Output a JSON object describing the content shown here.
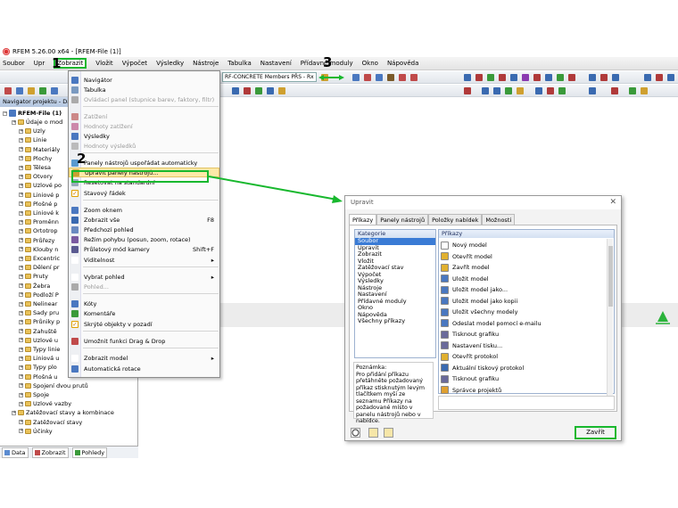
{
  "window": {
    "title": "RFEM 5.26.00 x64 - [RFEM-File (1)]"
  },
  "menubar": {
    "items": [
      "Soubor",
      "Upr",
      "Zobrazit",
      "Vložit",
      "Výpočet",
      "Výsledky",
      "Nástroje",
      "Tabulka",
      "Nastavení",
      "Přídavné moduly",
      "Okno",
      "Nápověda"
    ],
    "active": "Zobrazit"
  },
  "toolbar": {
    "combo_value": "RF-CONCRETE Members PŘS - Rx"
  },
  "navigator": {
    "title": "Navigator projektu - Dat",
    "root": "RFEM-File (1)",
    "items": [
      "Údaje o mod",
      "Uzly",
      "Linie",
      "Materiály",
      "Plochy",
      "Tělesa",
      "Otvory",
      "Uzlové po",
      "Liniové p",
      "Plošné p",
      "Liniové k",
      "Proměnn",
      "Ortotrop",
      "Průřezy",
      "Klouby n",
      "Excentric",
      "Dělení pr",
      "Pruty",
      "Žebra",
      "Podloží P",
      "Nelinear",
      "Sady pru",
      "Průniky p",
      "Zahuště",
      "Uzlové u",
      "Typy linie",
      "Liniová u",
      "Typy plo",
      "Plošná u",
      "Spojení dvou prutů",
      "Spoje",
      "Uzlové vazby",
      "Zatěžovací stavy a kombinace",
      "Zatěžovací stavy",
      "Účinky"
    ],
    "tabs": [
      "Data",
      "Zobrazit",
      "Pohledy"
    ]
  },
  "dropdown": {
    "items": [
      {
        "label": "Navigátor",
        "shortcut": ""
      },
      {
        "label": "Tabulka",
        "shortcut": ""
      },
      {
        "label": "Ovládací panel (stupnice barev, faktory, filtr)",
        "shortcut": ""
      },
      {
        "label": "Zatížení",
        "shortcut": ""
      },
      {
        "label": "Hodnoty zatížení",
        "shortcut": ""
      },
      {
        "label": "Výsledky",
        "shortcut": ""
      },
      {
        "label": "Hodnoty výsledků",
        "shortcut": ""
      },
      {
        "label": "Panely nástrojů uspořádat automaticky",
        "shortcut": ""
      },
      {
        "label": "Upravit panely nástrojů...",
        "shortcut": ""
      },
      {
        "label": "Resetovat na standardní",
        "shortcut": ""
      },
      {
        "label": "Stavový řádek",
        "shortcut": ""
      },
      {
        "label": "Zoom oknem",
        "shortcut": ""
      },
      {
        "label": "Zobrazit vše",
        "shortcut": "F8"
      },
      {
        "label": "Předchozí pohled",
        "shortcut": ""
      },
      {
        "label": "Režim pohybu (posun, zoom, rotace)",
        "shortcut": ""
      },
      {
        "label": "Průletový mód kamery",
        "shortcut": "Shift+F"
      },
      {
        "label": "Viditelnost",
        "shortcut": "▸"
      },
      {
        "label": "Vybrat pohled",
        "shortcut": "▸"
      },
      {
        "label": "Pohled...",
        "shortcut": ""
      },
      {
        "label": "Kóty",
        "shortcut": ""
      },
      {
        "label": "Komentáře",
        "shortcut": ""
      },
      {
        "label": "Skrýté objekty v pozadí",
        "shortcut": ""
      },
      {
        "label": "Umožnit funkci Drag & Drop",
        "shortcut": ""
      },
      {
        "label": "Zobrazit model",
        "shortcut": "▸"
      },
      {
        "label": "Automatická rotace",
        "shortcut": ""
      }
    ]
  },
  "markers": [
    "1",
    "2",
    "3",
    "4"
  ],
  "dialog": {
    "title": "Upravit",
    "close_glyph": "✕",
    "tabs": [
      "Příkazy",
      "Panely nástrojů",
      "Položky nabídek",
      "Možnosti"
    ],
    "categories_header": "Kategorie",
    "categories": [
      "Soubor",
      "Upravit",
      "Zobrazit",
      "Vložit",
      "Zatěžovací stav",
      "Výpočet",
      "Výsledky",
      "Nástroje",
      "Nastavení",
      "Přídavné moduly",
      "Okno",
      "Nápověda",
      "Všechny příkazy"
    ],
    "commands_header": "Příkazy",
    "commands": [
      "Nový model",
      "Otevřít model",
      "Zavřít model",
      "Uložit model",
      "Uložit model jako...",
      "Uložit model jako kopii",
      "Uložit všechny modely",
      "Odeslat model pomocí e-mailu",
      "Tisknout grafiku",
      "Nastavení tisku...",
      "Otevřít protokol",
      "Aktuální tiskový protokol",
      "Tisknout grafiku",
      "Správce projektů"
    ],
    "note": "Poznámka:\nPro přidání příkazu přetáhněte požadovaný příkaz stisknutým levým tlačítkem myši ze seznamu Příkazy na požadované místo v panelu nástrojů nebo v nabídce.",
    "close_button": "Zavřít"
  },
  "colors": {
    "highlight_green": "#18b82e",
    "menu_highlight": "#fde9a8",
    "selection_blue": "#3a7bd5"
  }
}
